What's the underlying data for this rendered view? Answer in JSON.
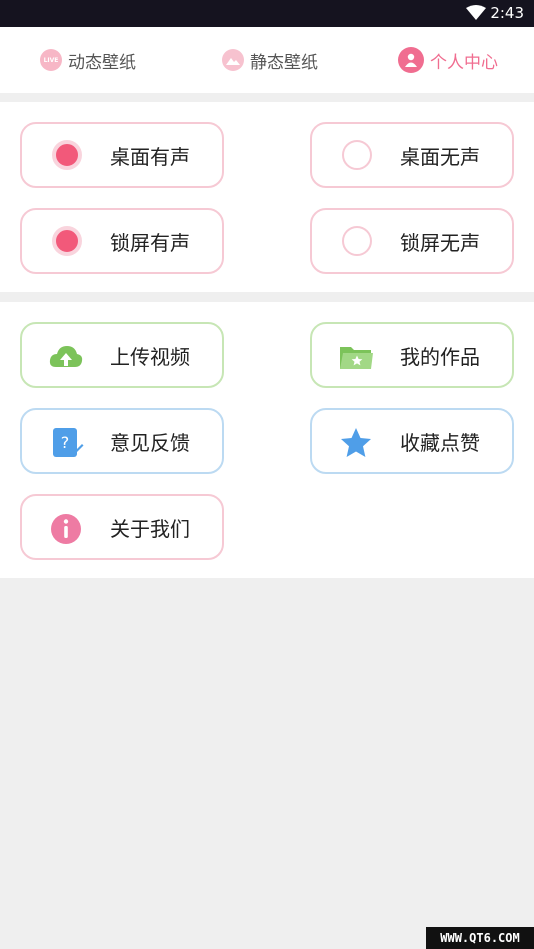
{
  "status_bar": {
    "time": "2:43"
  },
  "tabs": [
    {
      "label": "动态壁纸",
      "icon": "live-icon",
      "active": false
    },
    {
      "label": "静态壁纸",
      "icon": "image-icon",
      "active": false
    },
    {
      "label": "个人中心",
      "icon": "user-icon",
      "active": true
    }
  ],
  "sound_options": [
    {
      "label": "桌面有声",
      "selected": true
    },
    {
      "label": "桌面无声",
      "selected": false
    },
    {
      "label": "锁屏有声",
      "selected": true
    },
    {
      "label": "锁屏无声",
      "selected": false
    }
  ],
  "menu": [
    {
      "label": "上传视频",
      "icon": "cloud-upload-icon"
    },
    {
      "label": "我的作品",
      "icon": "folder-star-icon"
    },
    {
      "label": "意见反馈",
      "icon": "feedback-icon"
    },
    {
      "label": "收藏点赞",
      "icon": "star-icon"
    },
    {
      "label": "关于我们",
      "icon": "info-icon"
    }
  ],
  "watermark": "WWW.QT6.COM",
  "colors": {
    "accent": "#f06d90",
    "radio_on": "#f2597a",
    "green": "#7cc35a",
    "blue": "#4f9ee8"
  }
}
